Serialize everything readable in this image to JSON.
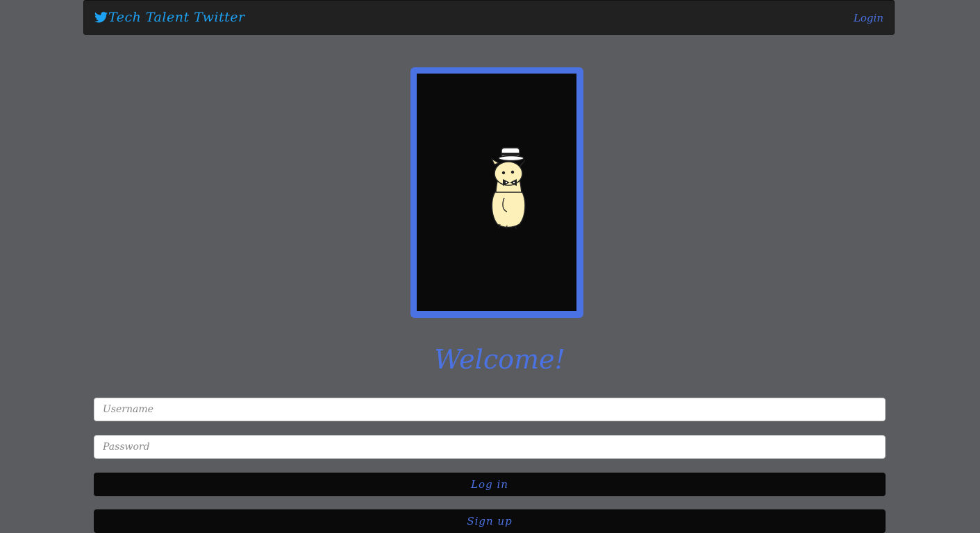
{
  "navbar": {
    "brand": "Tech Talent Twitter",
    "brand_icon": "twitter-bird-icon",
    "login_link": "Login"
  },
  "hero": {
    "image": "alpaca-mascot-with-top-hat"
  },
  "form": {
    "heading": "Welcome!",
    "username_placeholder": "Username",
    "password_placeholder": "Password",
    "login_button": "Log in",
    "signup_button": "Sign up"
  },
  "colors": {
    "background": "#5b5c60",
    "navbar": "#212121",
    "brand": "#1da1f2",
    "accent": "#4a72e2",
    "button": "#0a0a0a"
  }
}
